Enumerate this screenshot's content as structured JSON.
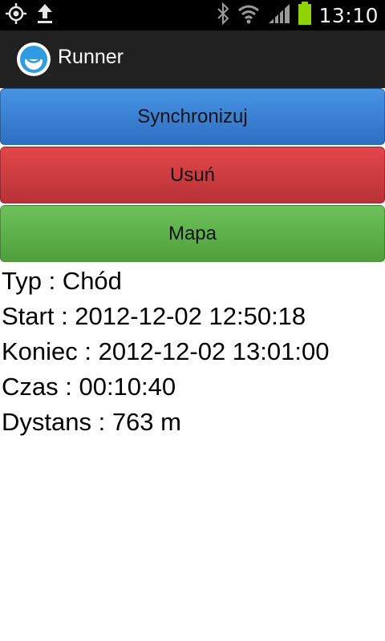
{
  "status_bar": {
    "time": "13:10",
    "icons": [
      "gps-icon",
      "upload-icon",
      "bluetooth-icon",
      "wifi-icon",
      "signal-icon",
      "battery-icon"
    ],
    "battery_color": "#8fd400"
  },
  "action_bar": {
    "title": "Runner",
    "icon": "runner-app-icon"
  },
  "buttons": {
    "sync": "Synchronizuj",
    "delete": "Usuń",
    "map": "Mapa"
  },
  "details": {
    "type": "Typ : Chód",
    "start": "Start : 2012-12-02 12:50:18",
    "end": "Koniec : 2012-12-02 13:01:00",
    "time": "Czas : 00:10:40",
    "distance": "Dystans : 763 m"
  },
  "colors": {
    "sync_button": "#3a82d4",
    "delete_button": "#cf3b3f",
    "map_button": "#5fb04b"
  }
}
